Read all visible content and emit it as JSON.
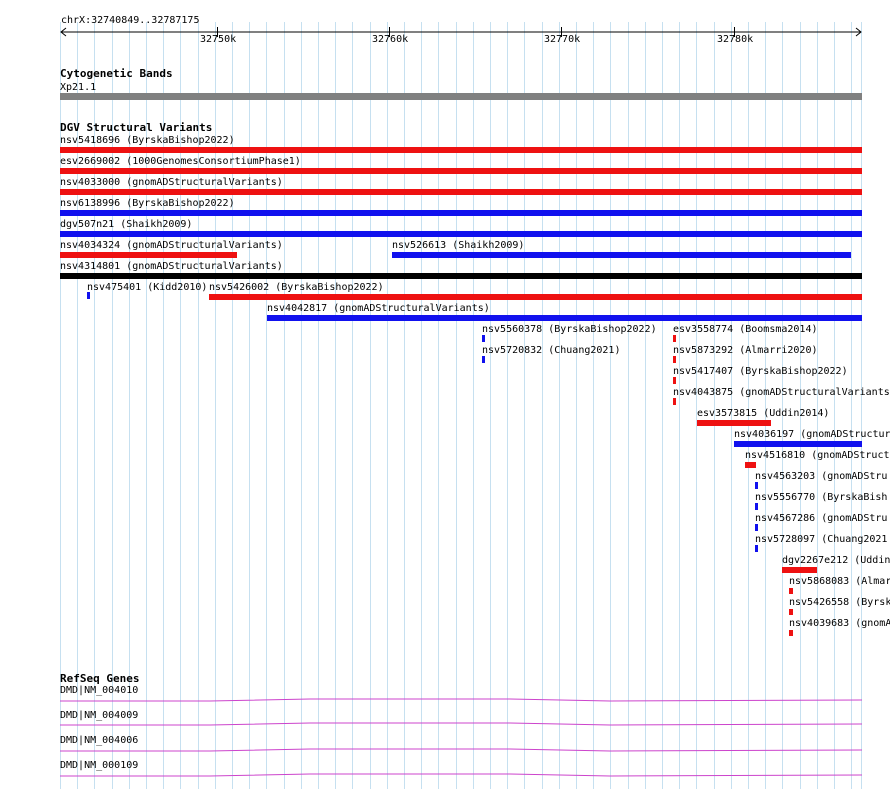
{
  "ruler": {
    "locus": "chrX:32740849..32787175",
    "ticks": [
      "32750k",
      "32760k",
      "32770k",
      "32780k"
    ]
  },
  "tracks": {
    "cytoband": {
      "title": "Cytogenetic Bands",
      "band_label": "Xp21.1",
      "color": "#808080"
    },
    "dgv": {
      "title": "DGV Structural Variants",
      "colors": {
        "loss": "#ee1111",
        "gain": "#1111ee",
        "complex": "#000000"
      },
      "features": [
        {
          "label": "nsv5418696 (ByrskaBishop2022)",
          "color": "loss"
        },
        {
          "label": "esv2669002 (1000GenomesConsortiumPhase1)",
          "color": "loss"
        },
        {
          "label": "nsv4033000 (gnomADStructuralVariants)",
          "color": "loss"
        },
        {
          "label": "nsv6138996 (ByrskaBishop2022)",
          "color": "gain"
        },
        {
          "label": "dgv507n21 (Shaikh2009)",
          "color": "gain"
        },
        {
          "label": "nsv4034324 (gnomADStructuralVariants)",
          "color": "loss"
        },
        {
          "label": "nsv526613 (Shaikh2009)",
          "color": "gain"
        },
        {
          "label": "nsv4314801 (gnomADStructuralVariants)",
          "color": "complex"
        },
        {
          "label": "nsv475401 (Kidd2010)",
          "color": "gain"
        },
        {
          "label": "nsv5426002 (ByrskaBishop2022)",
          "color": "loss"
        },
        {
          "label": "nsv4042817 (gnomADStructuralVariants)",
          "color": "gain"
        },
        {
          "label": "nsv5560378 (ByrskaBishop2022)",
          "color": "gain"
        },
        {
          "label": "esv3558774 (Boomsma2014)",
          "color": "loss"
        },
        {
          "label": "nsv5720832 (Chuang2021)",
          "color": "gain"
        },
        {
          "label": "nsv5873292 (Almarri2020)",
          "color": "loss"
        },
        {
          "label": "nsv5417407 (ByrskaBishop2022)",
          "color": "loss"
        },
        {
          "label": "nsv4043875 (gnomADStructuralVariants",
          "color": "loss"
        },
        {
          "label": "esv3573815 (Uddin2014)",
          "color": "loss"
        },
        {
          "label": "nsv4036197 (gnomADStructur",
          "color": "gain"
        },
        {
          "label": "nsv4516810 (gnomADStruct",
          "color": "loss"
        },
        {
          "label": "nsv4563203 (gnomADStru",
          "color": "gain"
        },
        {
          "label": "nsv5556770 (ByrskaBish",
          "color": "gain"
        },
        {
          "label": "nsv4567286 (gnomADStru",
          "color": "gain"
        },
        {
          "label": "nsv5728097 (Chuang2021",
          "color": "gain"
        },
        {
          "label": "dgv2267e212 (Uddin",
          "color": "loss"
        },
        {
          "label": "nsv5868083 (Almar",
          "color": "loss"
        },
        {
          "label": "nsv5426558 (Byrsk",
          "color": "loss"
        },
        {
          "label": "nsv4039683 (gnomA",
          "color": "loss"
        }
      ]
    },
    "refseq": {
      "title": "RefSeq Genes",
      "color": "#cc44cc",
      "genes": [
        {
          "label": "DMD|NM_004010"
        },
        {
          "label": "DMD|NM_004009"
        },
        {
          "label": "DMD|NM_004006"
        },
        {
          "label": "DMD|NM_000109"
        }
      ]
    }
  }
}
